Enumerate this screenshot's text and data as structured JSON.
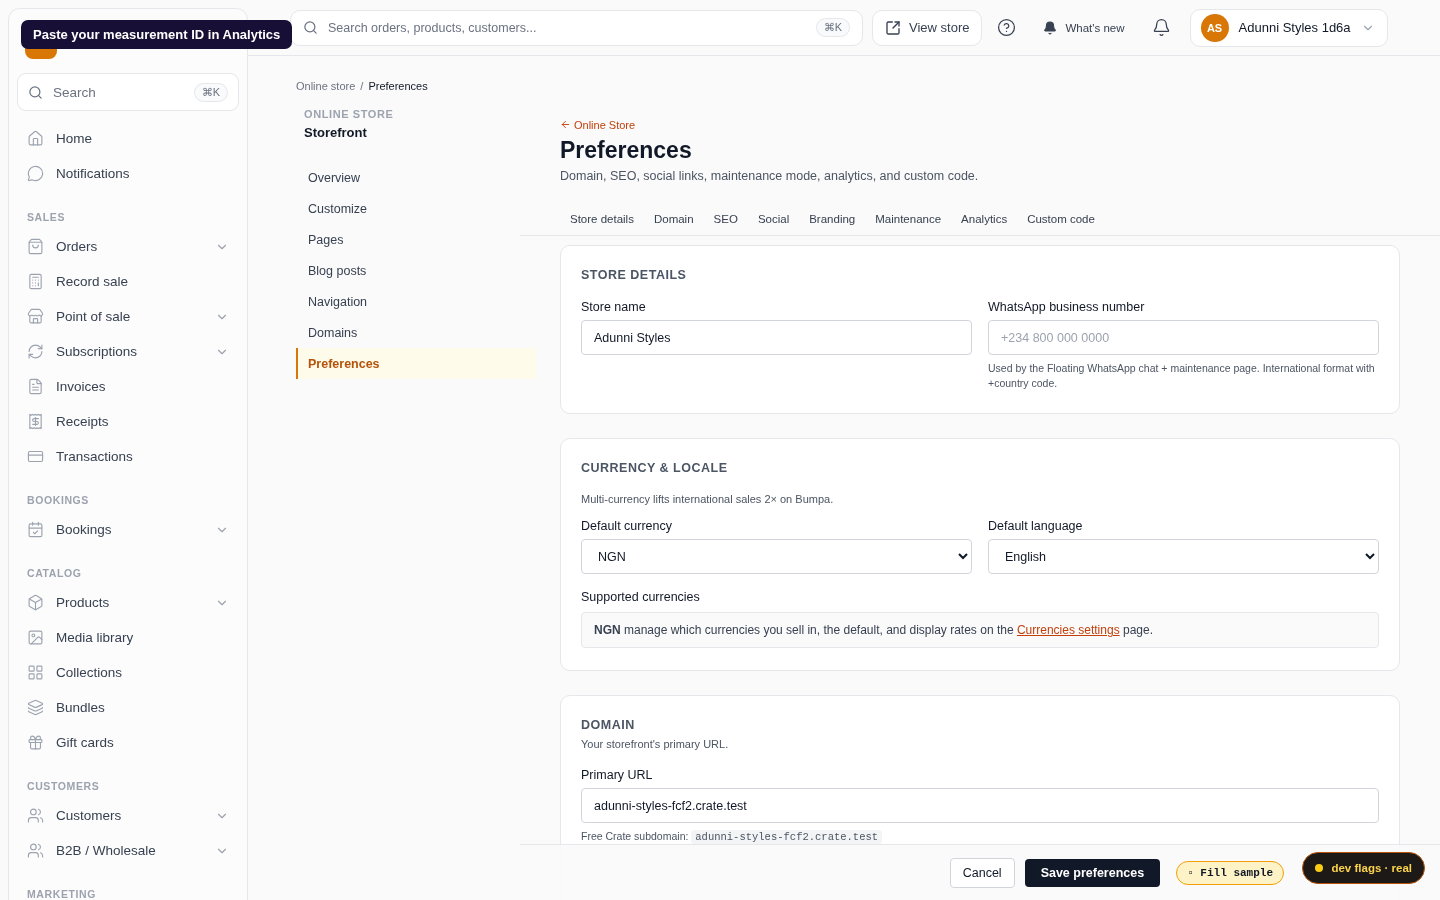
{
  "tooltip": "Paste your measurement ID in Analytics",
  "sidebar": {
    "search": "Search",
    "shortcut": "⌘K",
    "groups": [
      {
        "items": [
          {
            "label": "Home",
            "expandable": false
          },
          {
            "label": "Notifications",
            "expandable": false
          }
        ]
      },
      {
        "title": "SALES",
        "items": [
          {
            "label": "Orders",
            "expandable": true
          },
          {
            "label": "Record sale",
            "expandable": false
          },
          {
            "label": "Point of sale",
            "expandable": true
          },
          {
            "label": "Subscriptions",
            "expandable": true
          },
          {
            "label": "Invoices",
            "expandable": false
          },
          {
            "label": "Receipts",
            "expandable": false
          },
          {
            "label": "Transactions",
            "expandable": false
          }
        ]
      },
      {
        "title": "BOOKINGS",
        "items": [
          {
            "label": "Bookings",
            "expandable": true
          }
        ]
      },
      {
        "title": "CATALOG",
        "items": [
          {
            "label": "Products",
            "expandable": true
          },
          {
            "label": "Media library",
            "expandable": false
          },
          {
            "label": "Collections",
            "expandable": false
          },
          {
            "label": "Bundles",
            "expandable": false
          },
          {
            "label": "Gift cards",
            "expandable": false
          }
        ]
      },
      {
        "title": "CUSTOMERS",
        "items": [
          {
            "label": "Customers",
            "expandable": true
          },
          {
            "label": "B2B / Wholesale",
            "expandable": true
          }
        ]
      },
      {
        "title": "MARKETING"
      }
    ]
  },
  "topbar": {
    "search_placeholder": "Search orders, products, customers...",
    "shortcut": "⌘K",
    "view_store": "View store",
    "whats_new": "What's new",
    "account": {
      "initials": "AS",
      "name": "Adunni Styles 1d6a"
    }
  },
  "breadcrumb": {
    "separator": "/",
    "items": [
      {
        "label": "Online store"
      },
      {
        "label": "Preferences"
      }
    ]
  },
  "subnav": {
    "section": "ONLINE STORE",
    "title": "Storefront",
    "items": [
      {
        "label": "Overview",
        "selected": false
      },
      {
        "label": "Customize",
        "selected": false
      },
      {
        "label": "Pages",
        "selected": false
      },
      {
        "label": "Blog posts",
        "selected": false
      },
      {
        "label": "Navigation",
        "selected": false
      },
      {
        "label": "Domains",
        "selected": false
      },
      {
        "label": "Preferences",
        "selected": true
      }
    ]
  },
  "header": {
    "back": "Online Store",
    "title": "Preferences",
    "description": "Domain, SEO, social links, maintenance mode, analytics, and custom code."
  },
  "tabs": [
    {
      "label": "Store details",
      "selected": false
    },
    {
      "label": "Domain",
      "selected": false
    },
    {
      "label": "SEO",
      "selected": false
    },
    {
      "label": "Social",
      "selected": false
    },
    {
      "label": "Branding",
      "selected": false
    },
    {
      "label": "Maintenance",
      "selected": false
    },
    {
      "label": "Analytics",
      "selected": false
    },
    {
      "label": "Custom code",
      "selected": false
    }
  ],
  "store_details": {
    "title": "STORE DETAILS",
    "store_name": {
      "label": "Store name",
      "value": "Adunni Styles"
    },
    "whatsapp": {
      "label": "WhatsApp business number",
      "placeholder": "+234 800 000 0000",
      "hint": "Used by the Floating WhatsApp chat + maintenance page. International format with +country code."
    }
  },
  "currency": {
    "title": "CURRENCY & LOCALE",
    "description": "Multi-currency lifts international sales 2× on Bumpa.",
    "default_currency": {
      "label": "Default currency",
      "value": "NGN"
    },
    "default_language": {
      "label": "Default language",
      "value": "English"
    },
    "supported": {
      "label": "Supported currencies",
      "before": "**NGN** manage which currencies you sell in, the default, and display rates on the",
      "link": "Currencies settings",
      "after": "page."
    }
  },
  "domain": {
    "title": "DOMAIN",
    "description": "Your storefront's primary URL.",
    "primary_url": {
      "label": "Primary URL",
      "value": "adunni-styles-fcf2.crate.test"
    },
    "free_label": "Free Crate subdomain:",
    "free_value": "adunni-styles-fcf2.crate.test"
  },
  "footer": {
    "cancel": "Cancel",
    "save": "Save preferences",
    "fill_sample": "▫ Fill sample"
  },
  "dev_badge": "dev flags · real"
}
